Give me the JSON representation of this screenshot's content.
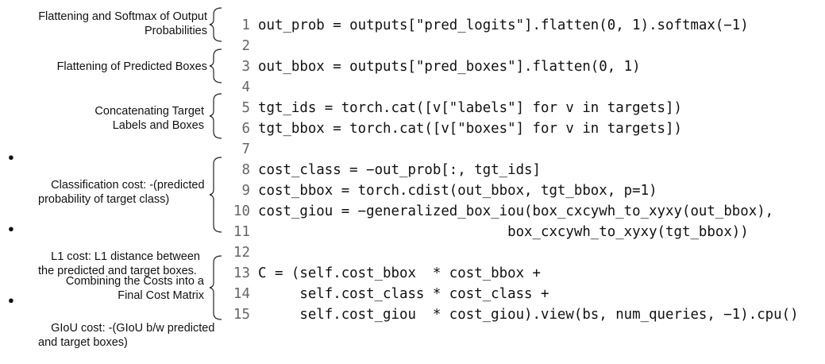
{
  "annotations": [
    {
      "id": "softmax",
      "text": "Flattening and Softmax of Output\nProbabilities"
    },
    {
      "id": "flat-boxes",
      "text": "Flattening of Predicted Boxes"
    },
    {
      "id": "concat",
      "text": "Concatenating Target\nLabels and Boxes"
    },
    {
      "id": "combine",
      "text": "Combining the Costs into a\nFinal Cost Matrix"
    }
  ],
  "bullets": [
    {
      "text": "Classification cost: -(predicted\nprobability of target class)"
    },
    {
      "text": "L1 cost: L1 distance between\nthe predicted and target boxes."
    },
    {
      "text": "GIoU cost: -(GIoU b/w predicted\nand target boxes)"
    }
  ],
  "code_lines": [
    {
      "n": "1",
      "code": "out_prob = outputs[\"pred_logits\"].flatten(0, 1).softmax(−1)"
    },
    {
      "n": "2",
      "code": ""
    },
    {
      "n": "3",
      "code": "out_bbox = outputs[\"pred_boxes\"].flatten(0, 1)"
    },
    {
      "n": "4",
      "code": ""
    },
    {
      "n": "5",
      "code": "tgt_ids = torch.cat([v[\"labels\"] for v in targets])"
    },
    {
      "n": "6",
      "code": "tgt_bbox = torch.cat([v[\"boxes\"] for v in targets])"
    },
    {
      "n": "7",
      "code": ""
    },
    {
      "n": "8",
      "code": "cost_class = −out_prob[:, tgt_ids]"
    },
    {
      "n": "9",
      "code": "cost_bbox = torch.cdist(out_bbox, tgt_bbox, p=1)"
    },
    {
      "n": "10",
      "code": "cost_giou = −generalized_box_iou(box_cxcywh_to_xyxy(out_bbox),"
    },
    {
      "n": "11",
      "code": "                              box_cxcywh_to_xyxy(tgt_bbox))"
    },
    {
      "n": "12",
      "code": ""
    },
    {
      "n": "13",
      "code": "C = (self.cost_bbox  * cost_bbox +"
    },
    {
      "n": "14",
      "code": "     self.cost_class * cost_class +"
    },
    {
      "n": "15",
      "code": "     self.cost_giou  * cost_giou).view(bs, num_queries, −1).cpu()"
    }
  ]
}
